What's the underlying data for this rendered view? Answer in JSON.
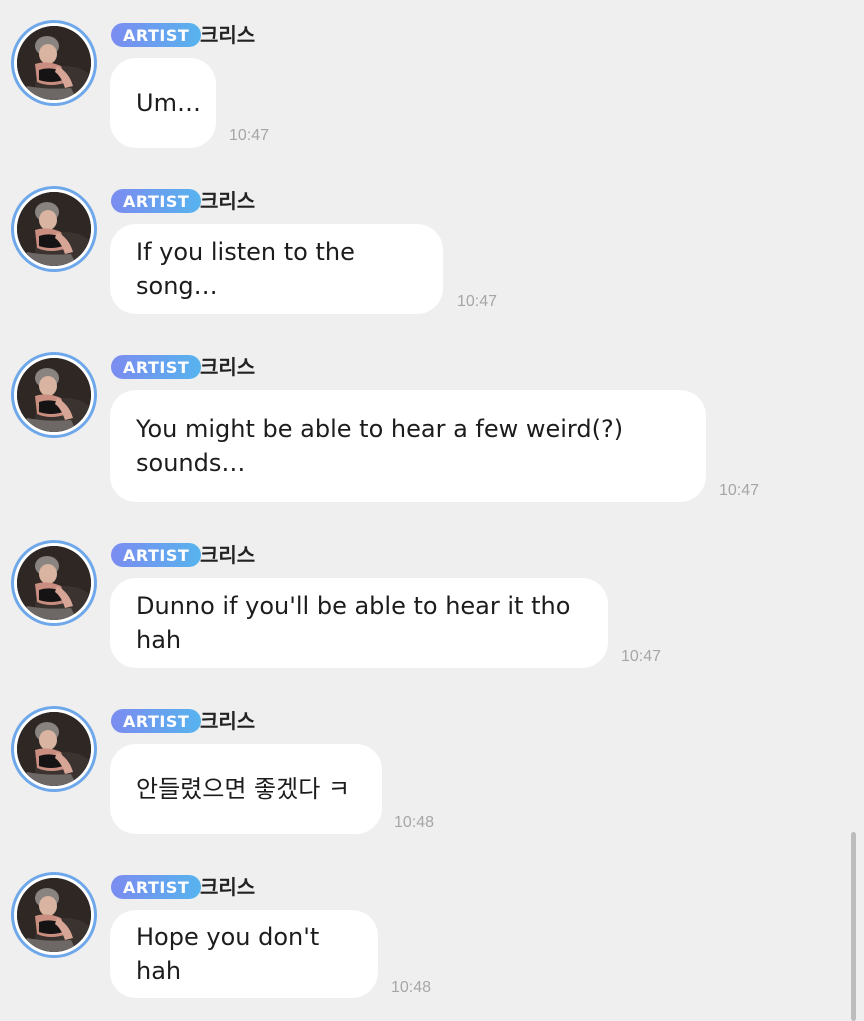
{
  "messages": [
    {
      "badge": "ARTIST",
      "name": "크리스",
      "text": "Um…",
      "time": "10:47"
    },
    {
      "badge": "ARTIST",
      "name": "크리스",
      "text": "If you listen to the song…",
      "time": "10:47"
    },
    {
      "badge": "ARTIST",
      "name": "크리스",
      "text": "You might be able to hear a few weird(?) sounds…",
      "time": "10:47"
    },
    {
      "badge": "ARTIST",
      "name": "크리스",
      "text": "Dunno if you'll be able to hear it tho hah",
      "time": "10:47"
    },
    {
      "badge": "ARTIST",
      "name": "크리스",
      "text": "안들렸으면 좋겠다 ㅋ",
      "time": "10:48"
    },
    {
      "badge": "ARTIST",
      "name": "크리스",
      "text": "Hope you don't hah",
      "time": "10:48"
    }
  ],
  "colors": {
    "background": "#efefef",
    "bubble": "#ffffff",
    "badge_start": "#7b8cf0",
    "badge_end": "#57b3ee",
    "avatar_ring": "#6fa8ea",
    "timestamp": "#a6a6a6"
  }
}
